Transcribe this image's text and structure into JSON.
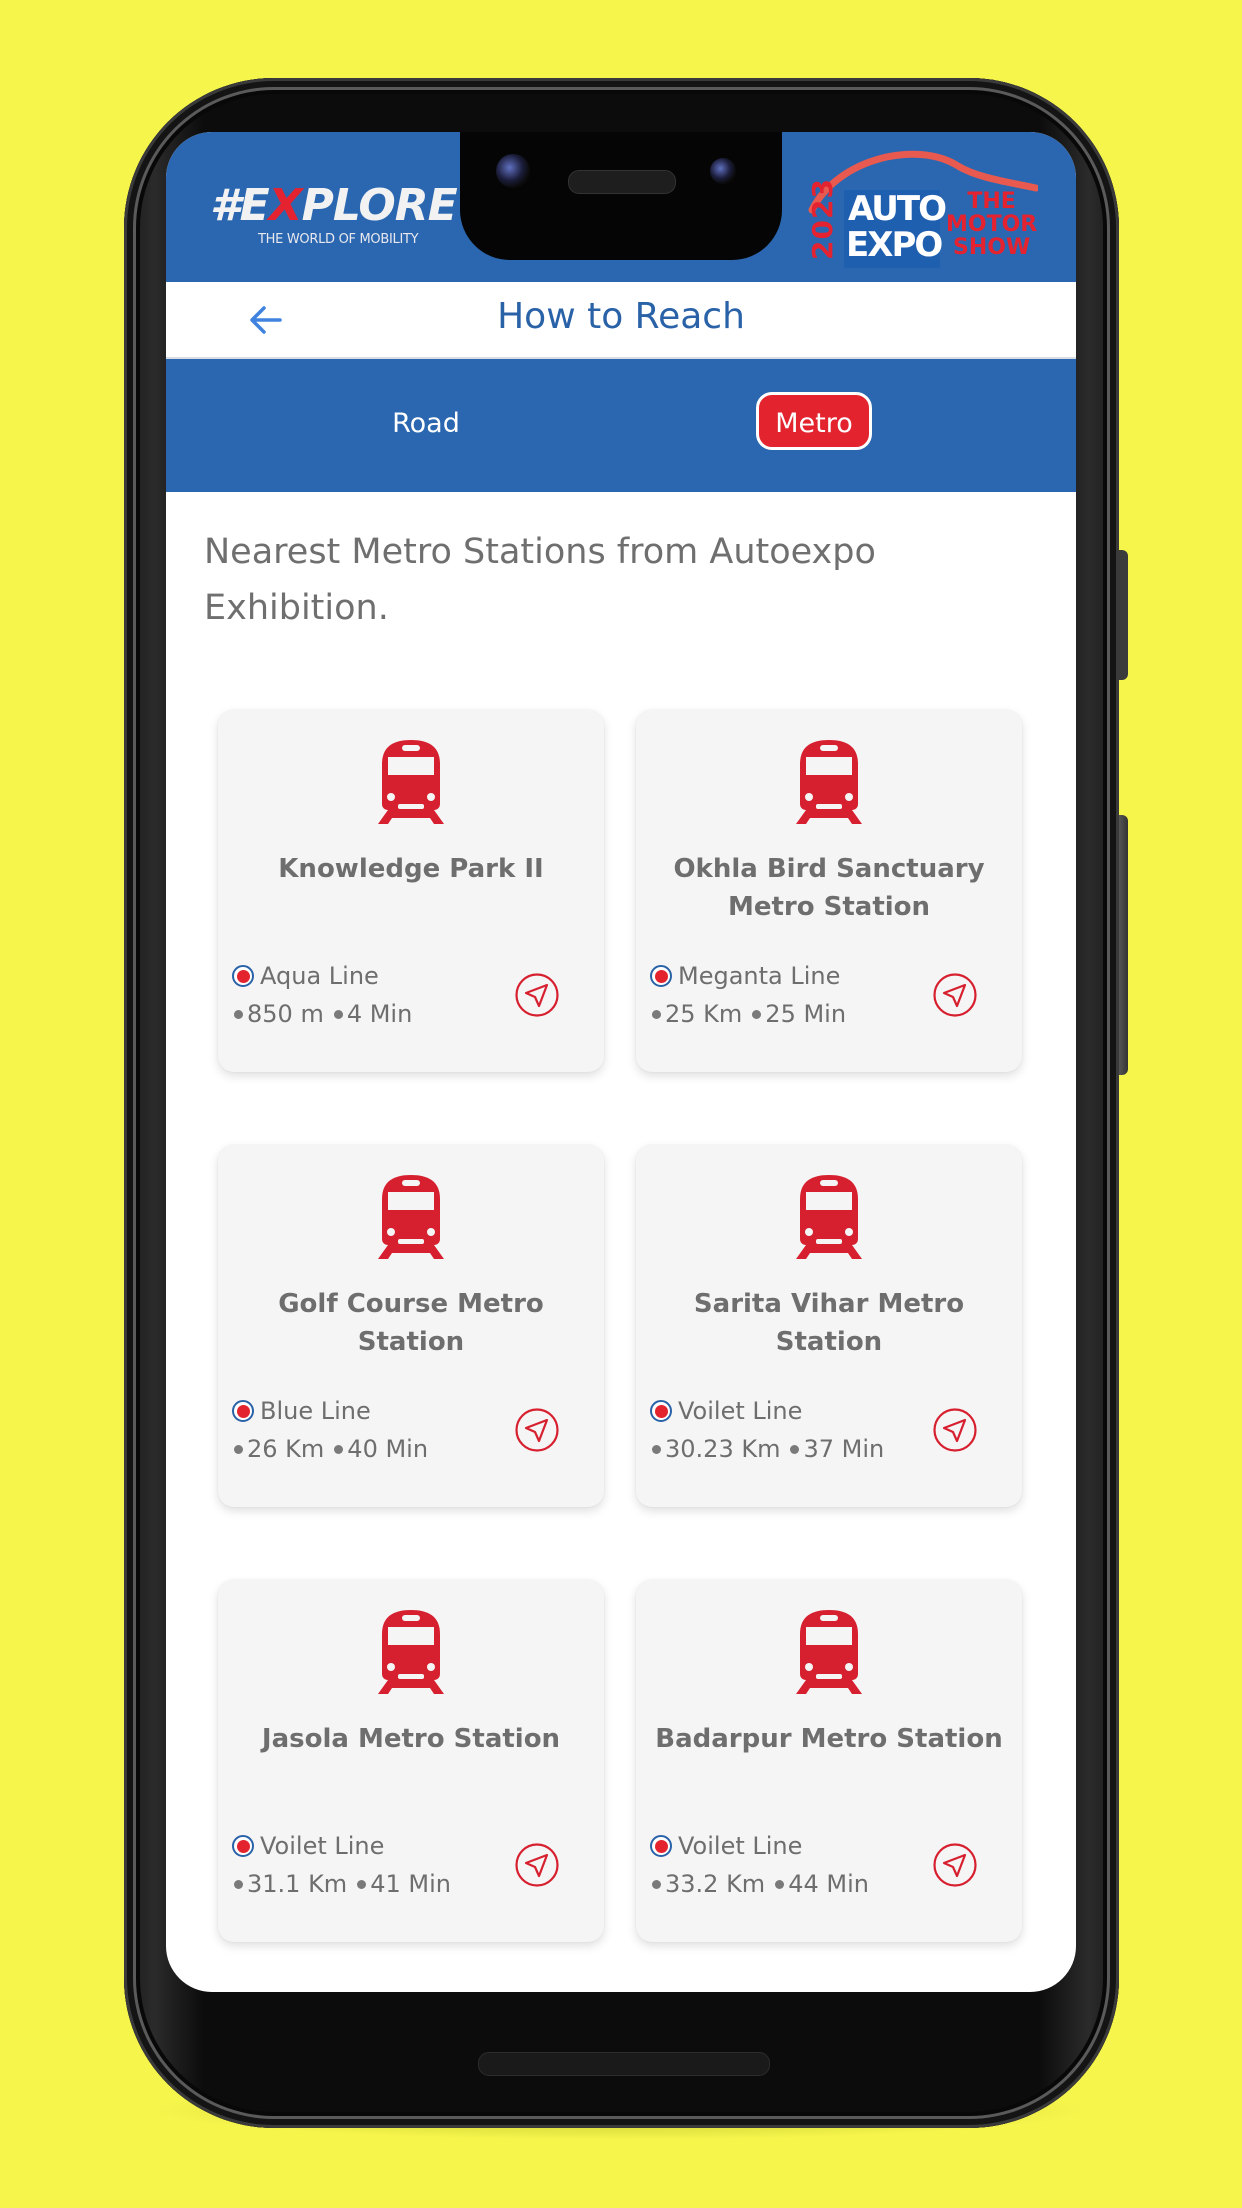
{
  "branding": {
    "explore_hash": "#E",
    "explore_x": "X",
    "explore_rest": "PLORE",
    "explore_tagline": "THE WORLD OF MOBILITY",
    "autoexpo_year": "2023",
    "autoexpo_auto": "AUTO",
    "autoexpo_expo": "EXPO",
    "autoexpo_tagline_1": "THE",
    "autoexpo_tagline_2": "MOTOR",
    "autoexpo_tagline_3": "SHOW"
  },
  "header": {
    "title": "How to Reach",
    "back_icon": "arrow-left-icon"
  },
  "tabs": [
    {
      "label": "Road",
      "active": false
    },
    {
      "label": "Metro",
      "active": true
    }
  ],
  "intro_text": "Nearest Metro Stations from Autoexpo Exhibition.",
  "colors": {
    "brand_blue": "#2a67b0",
    "accent_red": "#e3242f",
    "background_yellow": "#f5f54c",
    "text_gray": "#6e6e6e"
  },
  "stations": [
    {
      "name": "Knowledge Park II",
      "line": "Aqua Line",
      "distance": "850 m",
      "time": "4 Min"
    },
    {
      "name": "Okhla Bird Sanctuary Metro Station",
      "line": "Meganta Line",
      "distance": "25 Km",
      "time": "25 Min"
    },
    {
      "name": "Golf Course Metro Station",
      "line": "Blue Line",
      "distance": "26 Km",
      "time": "40 Min"
    },
    {
      "name": "Sarita Vihar Metro Station",
      "line": "Voilet Line",
      "distance": "30.23 Km",
      "time": "37 Min"
    },
    {
      "name": "Jasola Metro Station",
      "line": "Voilet Line",
      "distance": "31.1 Km",
      "time": "41 Min"
    },
    {
      "name": "Badarpur Metro Station",
      "line": "Voilet Line",
      "distance": "33.2 Km",
      "time": "44 Min"
    }
  ],
  "icons": {
    "station": "train-icon",
    "line_marker": "line-marker-icon",
    "navigate": "navigation-arrow-icon"
  }
}
